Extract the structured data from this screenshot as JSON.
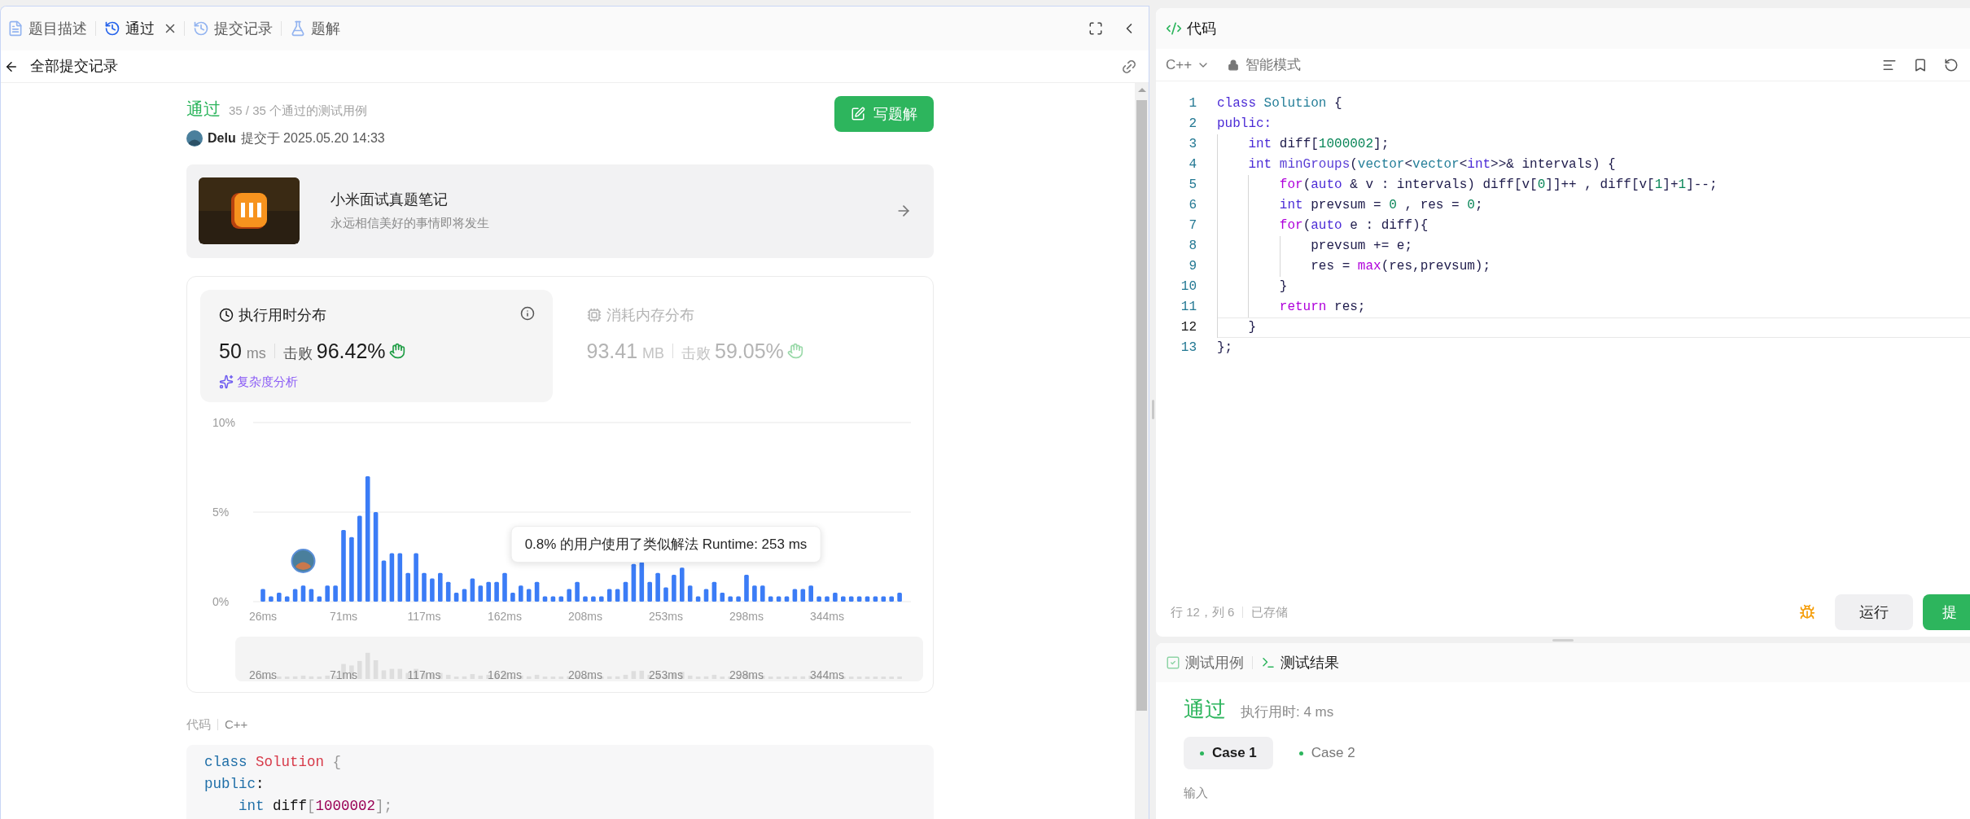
{
  "left_tabs": [
    {
      "label": "题目描述",
      "selected": false,
      "closable": false
    },
    {
      "label": "通过",
      "selected": true,
      "closable": true
    },
    {
      "label": "提交记录",
      "selected": false,
      "closable": false
    },
    {
      "label": "题解",
      "selected": false,
      "closable": false
    }
  ],
  "back_title": "全部提交记录",
  "submission": {
    "status": "通过",
    "cases": "35 / 35 个通过的测试用例",
    "author": "Delu",
    "submitted": "提交于 2025.05.20 14:33",
    "write_button": "写题解"
  },
  "banner": {
    "title": "小米面试真题笔记",
    "subtitle": "永远相信美好的事情即将发生"
  },
  "metrics": [
    {
      "kind": "runtime",
      "title": "执行用时分布",
      "value": "50",
      "unit": "ms",
      "beat_label": "击败",
      "beat": "96.42%",
      "selected": true,
      "link": "复杂度分析"
    },
    {
      "kind": "memory",
      "title": "消耗内存分布",
      "value": "93.41",
      "unit": "MB",
      "beat_label": "击败",
      "beat": "59.05%",
      "selected": false
    }
  ],
  "chart_data": {
    "type": "bar",
    "categories": [
      "26ms",
      null,
      null,
      null,
      null,
      null,
      null,
      null,
      null,
      null,
      "71ms",
      null,
      null,
      null,
      null,
      null,
      null,
      null,
      null,
      null,
      "117ms",
      null,
      null,
      null,
      null,
      null,
      null,
      null,
      null,
      null,
      "162ms",
      null,
      null,
      null,
      null,
      null,
      null,
      null,
      null,
      null,
      "208ms",
      null,
      null,
      null,
      null,
      null,
      null,
      null,
      null,
      null,
      "253ms",
      null,
      null,
      null,
      null,
      null,
      null,
      null,
      null,
      null,
      "298ms",
      null,
      null,
      null,
      null,
      null,
      null,
      null,
      null,
      null,
      "344ms",
      null,
      null,
      null,
      null,
      null,
      null,
      null,
      null,
      null
    ],
    "values": [
      0.7,
      0.3,
      0.5,
      0.3,
      0.7,
      0.9,
      0.7,
      0.3,
      0.9,
      0.9,
      4.0,
      3.6,
      4.8,
      7.0,
      5.0,
      2.3,
      2.7,
      2.7,
      1.6,
      2.7,
      1.6,
      1.3,
      1.6,
      1.1,
      0.5,
      0.7,
      1.3,
      0.9,
      1.1,
      1.1,
      1.6,
      0.5,
      0.9,
      0.7,
      1.1,
      0.3,
      0.3,
      0.3,
      0.7,
      1.1,
      0.3,
      0.3,
      0.3,
      0.7,
      0.7,
      1.1,
      2.1,
      2.2,
      1.1,
      1.6,
      0.8,
      1.5,
      1.9,
      0.9,
      0.3,
      0.7,
      1.1,
      0.5,
      0.3,
      0.3,
      1.5,
      0.9,
      0.9,
      0.3,
      0.3,
      0.3,
      0.7,
      0.7,
      0.9,
      0.3,
      0.3,
      0.5,
      0.3,
      0.3,
      0.3,
      0.3,
      0.3,
      0.3,
      0.3,
      0.5
    ],
    "ylim": [
      0,
      10
    ],
    "yticks": [
      {
        "value": 0,
        "label": "0%"
      },
      {
        "value": 5,
        "label": "5%"
      },
      {
        "value": 10,
        "label": "10%"
      }
    ],
    "annotations": [
      "0.8% 的用户使用了类似解法 Runtime: 253 ms"
    ]
  },
  "overview_labels": [
    "26ms",
    "71ms",
    "117ms",
    "162ms",
    "208ms",
    "253ms",
    "298ms",
    "344ms"
  ],
  "code_section": {
    "label": "代码",
    "language": "C++",
    "lines": [
      {
        "tokens": [
          {
            "text": "class ",
            "kind": "kw"
          },
          {
            "text": "Solution",
            "kind": "cls"
          },
          {
            "text": " {",
            "kind": "punct"
          }
        ]
      },
      {
        "tokens": [
          {
            "text": "public",
            "kind": "kw"
          },
          {
            "text": ":",
            "kind": "p"
          }
        ]
      },
      {
        "tokens": [
          {
            "text": "    int",
            "kind": "kw"
          },
          {
            "text": " diff",
            "kind": "p"
          },
          {
            "text": "[",
            "kind": "punct"
          },
          {
            "text": "1000002",
            "kind": "num"
          },
          {
            "text": "];",
            "kind": "punct"
          }
        ]
      }
    ]
  },
  "editor": {
    "title": "代码",
    "language": "C++",
    "mode": "智能模式",
    "lines": [
      {
        "number": "1",
        "selected": false,
        "tokens": [
          {
            "text": "class ",
            "kind": "kw"
          },
          {
            "text": "Solution",
            "kind": "type"
          },
          {
            "text": " {",
            "kind": "p"
          }
        ]
      },
      {
        "number": "2",
        "selected": false,
        "tokens": [
          {
            "text": "public:",
            "kind": "kw"
          }
        ]
      },
      {
        "number": "3",
        "selected": false,
        "tokens": [
          {
            "text": "    int",
            "kind": "kw"
          },
          {
            "text": " diff[",
            "kind": "p"
          },
          {
            "text": "1000002",
            "kind": "num"
          },
          {
            "text": "];",
            "kind": "p"
          }
        ]
      },
      {
        "number": "4",
        "selected": false,
        "tokens": [
          {
            "text": "    int ",
            "kind": "kw"
          },
          {
            "text": "minGroups",
            "kind": "fn"
          },
          {
            "text": "(",
            "kind": "p"
          },
          {
            "text": "vector",
            "kind": "type"
          },
          {
            "text": "<",
            "kind": "p"
          },
          {
            "text": "vector",
            "kind": "type"
          },
          {
            "text": "<",
            "kind": "p"
          },
          {
            "text": "int",
            "kind": "kw"
          },
          {
            "text": ">>& intervals) {",
            "kind": "p"
          }
        ]
      },
      {
        "number": "5",
        "selected": false,
        "tokens": [
          {
            "text": "        for",
            "kind": "ctl"
          },
          {
            "text": "(",
            "kind": "p"
          },
          {
            "text": "auto",
            "kind": "kw"
          },
          {
            "text": " & v : intervals) diff[v[",
            "kind": "p"
          },
          {
            "text": "0",
            "kind": "num"
          },
          {
            "text": "]]++ , diff[v[",
            "kind": "p"
          },
          {
            "text": "1",
            "kind": "num"
          },
          {
            "text": "]+",
            "kind": "p"
          },
          {
            "text": "1",
            "kind": "num"
          },
          {
            "text": "]--;",
            "kind": "p"
          }
        ]
      },
      {
        "number": "6",
        "selected": false,
        "tokens": [
          {
            "text": "        int",
            "kind": "kw"
          },
          {
            "text": " prevsum = ",
            "kind": "p"
          },
          {
            "text": "0",
            "kind": "num"
          },
          {
            "text": " , res = ",
            "kind": "p"
          },
          {
            "text": "0",
            "kind": "num"
          },
          {
            "text": ";",
            "kind": "p"
          }
        ]
      },
      {
        "number": "7",
        "selected": false,
        "tokens": [
          {
            "text": "        for",
            "kind": "ctl"
          },
          {
            "text": "(",
            "kind": "p"
          },
          {
            "text": "auto",
            "kind": "kw"
          },
          {
            "text": " e : diff){",
            "kind": "p"
          }
        ]
      },
      {
        "number": "8",
        "selected": false,
        "tokens": [
          {
            "text": "            prevsum += e;",
            "kind": "p"
          }
        ]
      },
      {
        "number": "9",
        "selected": false,
        "tokens": [
          {
            "text": "            res = ",
            "kind": "p"
          },
          {
            "text": "max",
            "kind": "ctl"
          },
          {
            "text": "(res,prevsum);",
            "kind": "p"
          }
        ]
      },
      {
        "number": "10",
        "selected": false,
        "tokens": [
          {
            "text": "        }",
            "kind": "p"
          }
        ]
      },
      {
        "number": "11",
        "selected": false,
        "tokens": [
          {
            "text": "        return",
            "kind": "ctl"
          },
          {
            "text": " res;",
            "kind": "p"
          }
        ]
      },
      {
        "number": "12",
        "selected": true,
        "tokens": [
          {
            "text": "    }",
            "kind": "p"
          }
        ]
      },
      {
        "number": "13",
        "selected": false,
        "tokens": [
          {
            "text": "};",
            "kind": "p"
          }
        ]
      }
    ],
    "status": "行 12，列 6",
    "saved": "已存储",
    "run": "运行",
    "submit": "提"
  },
  "results": {
    "tabs": [
      {
        "label": "测试用例",
        "selected": false
      },
      {
        "label": "测试结果",
        "selected": true
      }
    ],
    "status": "通过",
    "runtime": "执行用时: 4 ms",
    "cases": [
      {
        "label": "Case 1",
        "selected": true
      },
      {
        "label": "Case 2",
        "selected": false
      }
    ],
    "input_label": "输入"
  }
}
